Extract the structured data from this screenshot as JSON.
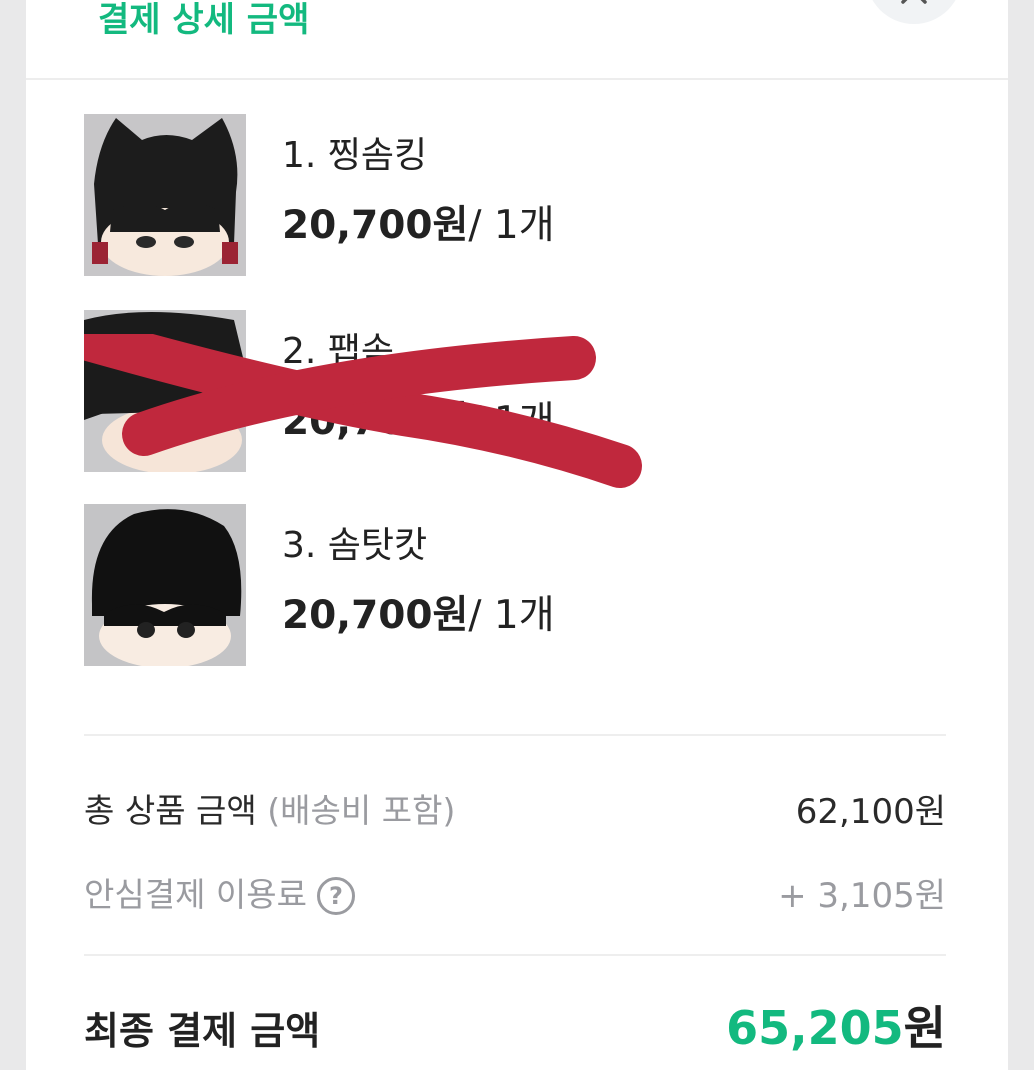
{
  "header": {
    "title": "결제 상세 금액",
    "close_icon": "close-icon"
  },
  "items": [
    {
      "name": "1. 찡솜킹",
      "price": "20,700원",
      "qty": "/ 1개",
      "crossed_out": false
    },
    {
      "name": "2. 팹솜",
      "price": "20,700원",
      "qty": "/ 1개",
      "crossed_out": true
    },
    {
      "name": "3. 솜탓캇",
      "price": "20,700원",
      "qty": "/ 1개",
      "crossed_out": false
    }
  ],
  "summary": {
    "total_label": "총 상품 금액",
    "total_note": "(배송비 포함)",
    "total_value": "62,100원",
    "fee_label": "안심결제 이용료",
    "fee_help_icon": "question-circle-icon",
    "fee_help_glyph": "?",
    "fee_value": "+ 3,105원"
  },
  "final": {
    "label": "최종 결제 금액",
    "amount": "65,205",
    "unit": "원"
  },
  "colors": {
    "accent": "#13b97f",
    "scribble": "#c0283d",
    "text": "#222222",
    "muted": "#9a9ba0"
  }
}
